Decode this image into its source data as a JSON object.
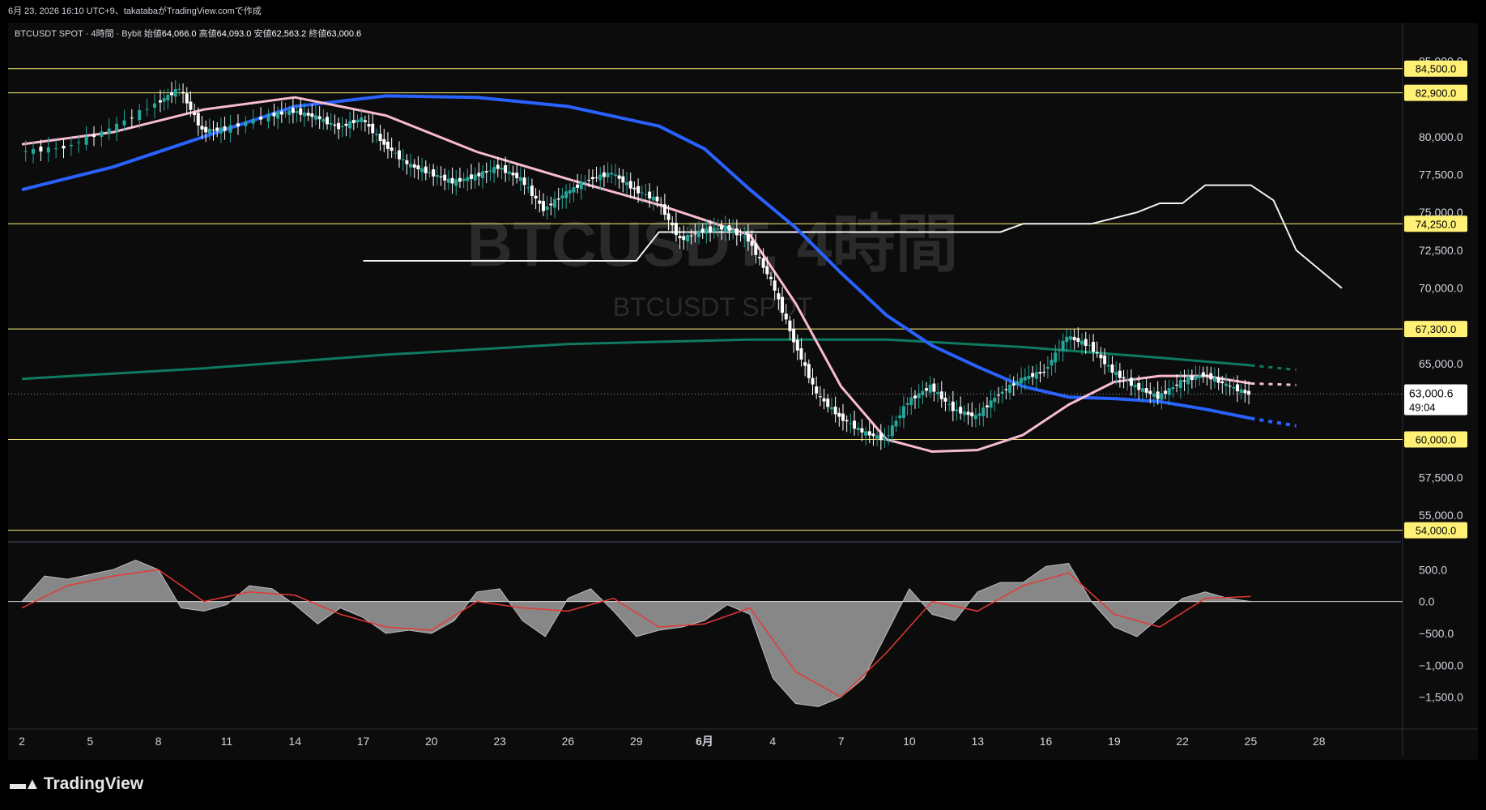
{
  "header": {
    "snapshot_info": "6月 23, 2026 16:10 UTC+9、takatabaがTradingView.comで作成"
  },
  "legend": {
    "symbol": "BTCUSDT SPOT · 4時間 · Bybit",
    "open_label": "始値",
    "open": "64,066.0",
    "high_label": "高値",
    "high": "64,093.0",
    "low_label": "安値",
    "low": "62,563.2",
    "close_label": "終値",
    "close": "63,000.6"
  },
  "watermark": {
    "title": "BTCUSDT, 4時間",
    "subtitle": "BTCUSDT SPOT"
  },
  "footer": {
    "brand": "TradingView"
  },
  "colors": {
    "background": "#0c0c0c",
    "up": "#26a69a",
    "down": "#ffffff",
    "ma_short": "#f8bbd0",
    "ma_mid": "#2962ff",
    "ma_long": "#0f7a5f",
    "level_line": "#fff176",
    "price_label_bg": "#ffffff",
    "oscillator_fill": "#9e9e9e",
    "signal_line": "#e53935"
  },
  "chart_data": [
    {
      "type": "candlestick",
      "title": "BTCUSDT SPOT · 4時間 · Bybit",
      "x_tick_labels": [
        "2",
        "5",
        "8",
        "11",
        "14",
        "17",
        "20",
        "23",
        "26",
        "29",
        "6月",
        "4",
        "7",
        "10",
        "13",
        "16",
        "19",
        "22",
        "25",
        "28"
      ],
      "y_tick_labels": [
        "85,000.0",
        "80,000.0",
        "77,500.0",
        "75,000.0",
        "72,500.0",
        "70,000.0",
        "65,000.0",
        "57,500.0",
        "55,000.0"
      ],
      "ylim": [
        53500,
        87000
      ],
      "horizontal_levels": [
        {
          "label": "84,500.0",
          "value": 84500
        },
        {
          "label": "82,900.0",
          "value": 82900
        },
        {
          "label": "74,250.0",
          "value": 74250
        },
        {
          "label": "67,300.0",
          "value": 67300
        },
        {
          "label": "60,000.0",
          "value": 60000
        },
        {
          "label": "54,000.0",
          "value": 54000
        }
      ],
      "last_price": {
        "label": "63,000.6",
        "value": 63000.6,
        "countdown": "49:04"
      },
      "price_path": [
        {
          "x": 0,
          "y": 79000
        },
        {
          "x": 2,
          "y": 79300
        },
        {
          "x": 4,
          "y": 80500
        },
        {
          "x": 6,
          "y": 82200
        },
        {
          "x": 7,
          "y": 83200
        },
        {
          "x": 8,
          "y": 80400
        },
        {
          "x": 9,
          "y": 80500
        },
        {
          "x": 11,
          "y": 81400
        },
        {
          "x": 12,
          "y": 81700
        },
        {
          "x": 13,
          "y": 81300
        },
        {
          "x": 14,
          "y": 80600
        },
        {
          "x": 15,
          "y": 81200
        },
        {
          "x": 16,
          "y": 79500
        },
        {
          "x": 17,
          "y": 78200
        },
        {
          "x": 18,
          "y": 77600
        },
        {
          "x": 19,
          "y": 77000
        },
        {
          "x": 20,
          "y": 77400
        },
        {
          "x": 21,
          "y": 78000
        },
        {
          "x": 22,
          "y": 77200
        },
        {
          "x": 23,
          "y": 75200
        },
        {
          "x": 24,
          "y": 76300
        },
        {
          "x": 25,
          "y": 77200
        },
        {
          "x": 26,
          "y": 77600
        },
        {
          "x": 27,
          "y": 76500
        },
        {
          "x": 28,
          "y": 75800
        },
        {
          "x": 29,
          "y": 73200
        },
        {
          "x": 30,
          "y": 73800
        },
        {
          "x": 31,
          "y": 74000
        },
        {
          "x": 32,
          "y": 73200
        },
        {
          "x": 33,
          "y": 70500
        },
        {
          "x": 34,
          "y": 66500
        },
        {
          "x": 35,
          "y": 63000
        },
        {
          "x": 36,
          "y": 61500
        },
        {
          "x": 37,
          "y": 60500
        },
        {
          "x": 38,
          "y": 60000
        },
        {
          "x": 39,
          "y": 62500
        },
        {
          "x": 40,
          "y": 63500
        },
        {
          "x": 41,
          "y": 62000
        },
        {
          "x": 42,
          "y": 61500
        },
        {
          "x": 43,
          "y": 63000
        },
        {
          "x": 44,
          "y": 64000
        },
        {
          "x": 45,
          "y": 64500
        },
        {
          "x": 46,
          "y": 66800
        },
        {
          "x": 47,
          "y": 66200
        },
        {
          "x": 48,
          "y": 64500
        },
        {
          "x": 49,
          "y": 63500
        },
        {
          "x": 50,
          "y": 62800
        },
        {
          "x": 51,
          "y": 63800
        },
        {
          "x": 52,
          "y": 64300
        },
        {
          "x": 53,
          "y": 63600
        },
        {
          "x": 54,
          "y": 63000
        }
      ],
      "indicators": [
        {
          "name": "ma_short",
          "values": [
            [
              0,
              79500
            ],
            [
              4,
              80300
            ],
            [
              8,
              81800
            ],
            [
              12,
              82600
            ],
            [
              16,
              81400
            ],
            [
              20,
              79000
            ],
            [
              24,
              77200
            ],
            [
              28,
              75500
            ],
            [
              32,
              73500
            ],
            [
              34,
              69000
            ],
            [
              36,
              63500
            ],
            [
              38,
              60000
            ],
            [
              40,
              59200
            ],
            [
              42,
              59300
            ],
            [
              44,
              60300
            ],
            [
              46,
              62300
            ],
            [
              48,
              63800
            ],
            [
              50,
              64200
            ],
            [
              52,
              64200
            ],
            [
              54,
              63700
            ],
            [
              56,
              63600
            ]
          ]
        },
        {
          "name": "ma_mid",
          "values": [
            [
              0,
              76500
            ],
            [
              4,
              78000
            ],
            [
              8,
              80000
            ],
            [
              12,
              82000
            ],
            [
              16,
              82700
            ],
            [
              20,
              82600
            ],
            [
              24,
              82000
            ],
            [
              28,
              80700
            ],
            [
              30,
              79200
            ],
            [
              32,
              76500
            ],
            [
              34,
              74000
            ],
            [
              36,
              71000
            ],
            [
              38,
              68200
            ],
            [
              40,
              66200
            ],
            [
              42,
              64800
            ],
            [
              44,
              63500
            ],
            [
              46,
              62800
            ],
            [
              48,
              62700
            ],
            [
              50,
              62500
            ],
            [
              52,
              62000
            ],
            [
              54,
              61400
            ],
            [
              56,
              60900
            ]
          ]
        },
        {
          "name": "ma_long",
          "values": [
            [
              0,
              64000
            ],
            [
              8,
              64700
            ],
            [
              16,
              65600
            ],
            [
              24,
              66300
            ],
            [
              32,
              66600
            ],
            [
              38,
              66600
            ],
            [
              44,
              66100
            ],
            [
              50,
              65400
            ],
            [
              54,
              64900
            ],
            [
              56,
              64600
            ]
          ]
        },
        {
          "name": "white_line",
          "values": [
            [
              15,
              71800
            ],
            [
              27,
              71800
            ],
            [
              28,
              73700
            ],
            [
              40,
              73700
            ],
            [
              43,
              73700
            ],
            [
              44,
              74250
            ],
            [
              47,
              74250
            ],
            [
              49,
              75000
            ],
            [
              50,
              75600
            ],
            [
              51,
              75600
            ],
            [
              52,
              76800
            ],
            [
              54,
              76800
            ],
            [
              55,
              75800
            ],
            [
              56,
              72500
            ],
            [
              58,
              70000
            ]
          ]
        }
      ]
    },
    {
      "type": "area",
      "title": "",
      "y_tick_labels": [
        "500.0",
        "0.0",
        "−500.0",
        "−1,000.0",
        "−1,500.0"
      ],
      "ylim": [
        -1950,
        1000
      ],
      "values": [
        [
          0,
          0
        ],
        [
          1,
          400
        ],
        [
          2,
          350
        ],
        [
          4,
          500
        ],
        [
          5,
          650
        ],
        [
          6,
          500
        ],
        [
          7,
          -100
        ],
        [
          8,
          -150
        ],
        [
          9,
          -50
        ],
        [
          10,
          250
        ],
        [
          11,
          200
        ],
        [
          12,
          -50
        ],
        [
          13,
          -350
        ],
        [
          14,
          -100
        ],
        [
          15,
          -250
        ],
        [
          16,
          -500
        ],
        [
          17,
          -450
        ],
        [
          18,
          -500
        ],
        [
          19,
          -300
        ],
        [
          20,
          150
        ],
        [
          21,
          200
        ],
        [
          22,
          -300
        ],
        [
          23,
          -550
        ],
        [
          24,
          50
        ],
        [
          25,
          200
        ],
        [
          26,
          -150
        ],
        [
          27,
          -550
        ],
        [
          28,
          -450
        ],
        [
          29,
          -400
        ],
        [
          30,
          -300
        ],
        [
          31,
          -50
        ],
        [
          32,
          -200
        ],
        [
          33,
          -1200
        ],
        [
          34,
          -1600
        ],
        [
          35,
          -1650
        ],
        [
          36,
          -1500
        ],
        [
          37,
          -1200
        ],
        [
          38,
          -500
        ],
        [
          39,
          200
        ],
        [
          40,
          -200
        ],
        [
          41,
          -300
        ],
        [
          42,
          150
        ],
        [
          43,
          300
        ],
        [
          44,
          300
        ],
        [
          45,
          550
        ],
        [
          46,
          600
        ],
        [
          47,
          0
        ],
        [
          48,
          -400
        ],
        [
          49,
          -550
        ],
        [
          50,
          -250
        ],
        [
          51,
          50
        ],
        [
          52,
          150
        ],
        [
          53,
          50
        ],
        [
          54,
          0
        ]
      ],
      "signal": [
        [
          0,
          -100
        ],
        [
          2,
          250
        ],
        [
          4,
          400
        ],
        [
          6,
          500
        ],
        [
          8,
          0
        ],
        [
          10,
          150
        ],
        [
          12,
          100
        ],
        [
          14,
          -200
        ],
        [
          16,
          -400
        ],
        [
          18,
          -450
        ],
        [
          20,
          0
        ],
        [
          22,
          -100
        ],
        [
          24,
          -150
        ],
        [
          26,
          50
        ],
        [
          28,
          -400
        ],
        [
          30,
          -350
        ],
        [
          32,
          -100
        ],
        [
          34,
          -1100
        ],
        [
          36,
          -1500
        ],
        [
          38,
          -800
        ],
        [
          40,
          0
        ],
        [
          42,
          -150
        ],
        [
          44,
          250
        ],
        [
          46,
          450
        ],
        [
          48,
          -200
        ],
        [
          50,
          -400
        ],
        [
          52,
          50
        ],
        [
          54,
          80
        ]
      ]
    }
  ]
}
